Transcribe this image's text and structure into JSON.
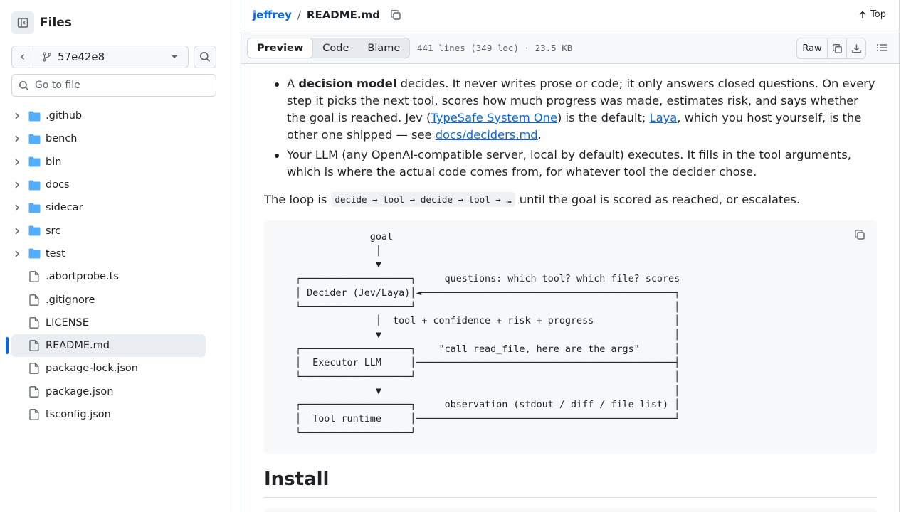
{
  "sidebar": {
    "title": "Files",
    "branch": "57e42e8",
    "goto_placeholder": "Go to file",
    "items": [
      {
        "label": ".github",
        "type": "folder"
      },
      {
        "label": "bench",
        "type": "folder"
      },
      {
        "label": "bin",
        "type": "folder"
      },
      {
        "label": "docs",
        "type": "folder"
      },
      {
        "label": "sidecar",
        "type": "folder"
      },
      {
        "label": "src",
        "type": "folder"
      },
      {
        "label": "test",
        "type": "folder"
      },
      {
        "label": ".abortprobe.ts",
        "type": "file"
      },
      {
        "label": ".gitignore",
        "type": "file"
      },
      {
        "label": "LICENSE",
        "type": "file"
      },
      {
        "label": "README.md",
        "type": "file",
        "active": true
      },
      {
        "label": "package-lock.json",
        "type": "file"
      },
      {
        "label": "package.json",
        "type": "file"
      },
      {
        "label": "tsconfig.json",
        "type": "file"
      }
    ]
  },
  "header": {
    "repo": "jeffrey",
    "separator": "/",
    "file": "README.md",
    "top_label": "Top"
  },
  "toolbar": {
    "tabs": [
      "Preview",
      "Code",
      "Blame"
    ],
    "active_tab": "Preview",
    "meta": "441 lines (349 loc) · 23.5 KB",
    "raw_label": "Raw"
  },
  "readme": {
    "bullet1": {
      "lead": "A ",
      "bold": "decision model",
      "text1": " decides. It never writes prose or code; it only answers closed questions. On every step it picks the next tool, scores how much progress was made, estimates risk, and says whether the goal is reached. Jev (",
      "link1": "TypeSafe System One",
      "text2": ") is the default; ",
      "link2": "Laya",
      "text3": ", which you host yourself, is the other one shipped — see ",
      "link3": "docs/deciders.md",
      "text4": "."
    },
    "bullet2": "Your LLM (any OpenAI-compatible server, local by default) executes. It fills in the tool arguments, which is where the actual code comes from, for whatever tool the decider chose.",
    "loop_prefix": "The loop is",
    "loop_code": "decide → tool → decide → tool → …",
    "loop_suffix": "until the goal is scored as reached, or escalates.",
    "diagram": "             goal\n              │\n              ▼\n┌───────────────────┐     questions: which tool? which file? scores\n│ Decider (Jev/Laya)│◄────────────────────────────────────────────┐\n└───────────────────┘                                             │\n              │  tool + confidence + risk + progress              │\n              ▼                                                   │\n┌───────────────────┐    \"call read_file, here are the args\"      │\n│  Executor LLM     │─────────────────────────────────────────────┤\n└───────────────────┘                                             │\n              ▼                                                   │\n┌───────────────────┐     observation (stdout / diff / file list) │\n│  Tool runtime     │─────────────────────────────────────────────┘\n└───────────────────┘",
    "install_heading": "Install"
  }
}
